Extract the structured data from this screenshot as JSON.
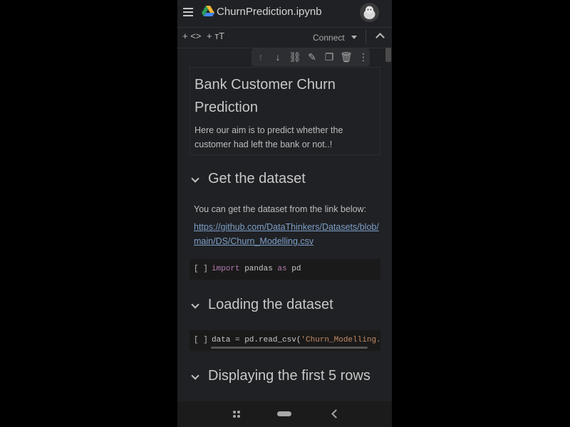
{
  "app": {
    "title": "ChurnPrediction.ipynb"
  },
  "toolbar": {
    "add_code": "+ <>",
    "add_text": "+ ᴛT",
    "connect": "Connect"
  },
  "cell_toolbar": {
    "icons": [
      "arrow-up",
      "arrow-down",
      "link",
      "edit",
      "mirror-cell",
      "delete",
      "more"
    ]
  },
  "notebook": {
    "intro": {
      "heading": "Bank Customer Churn Prediction",
      "text": "Here our aim is to predict whether the customer had left the bank or not..!"
    },
    "section1": {
      "heading": "Get the dataset",
      "text": "You can get the dataset from the link below:",
      "link": "https://github.com/DataThinkers/Datasets/blob/main/DS/Churn_Modelling.csv",
      "code": {
        "run": "[ ]",
        "kw1": "import",
        "mid": " pandas ",
        "kw2": "as",
        "end": " pd"
      }
    },
    "section2": {
      "heading": "Loading the dataset",
      "code": {
        "run": "[ ]",
        "pre": "data = pd.read_csv(",
        "str": "'Churn_Modelling.csv"
      }
    },
    "section3": {
      "heading": "Displaying the first 5 rows"
    }
  },
  "colors": {
    "background": "#202124",
    "link": "#7c9fc8",
    "keyword": "#b37bb0",
    "string": "#c48a63"
  }
}
